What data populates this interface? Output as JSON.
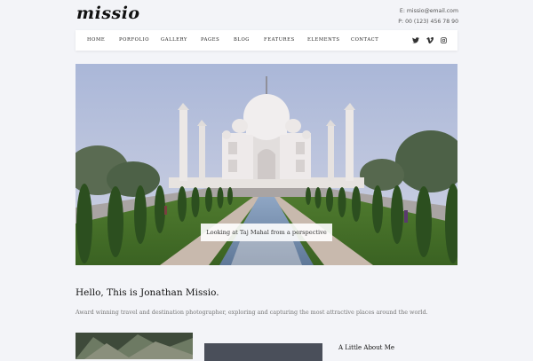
{
  "header": {
    "logo": "missio",
    "email": "E: missio@email.com",
    "phone": "P: 00 (123) 456 78 90"
  },
  "nav": {
    "items": [
      "HOME",
      "PORFOLIO",
      "GALLERY",
      "PAGES",
      "BLOG",
      "FEATURES",
      "ELEMENTS",
      "CONTACT"
    ],
    "social": [
      "twitter-icon",
      "vimeo-icon",
      "instagram-icon"
    ]
  },
  "hero": {
    "caption": "Looking at Taj Mahal from a perspective"
  },
  "intro": {
    "title": "Hello, This is Jonathan Missio.",
    "text": "Award winning travel and destination photographer, exploring and capturing the most attractive places around the world."
  },
  "about": {
    "title": "A Little About Me"
  }
}
